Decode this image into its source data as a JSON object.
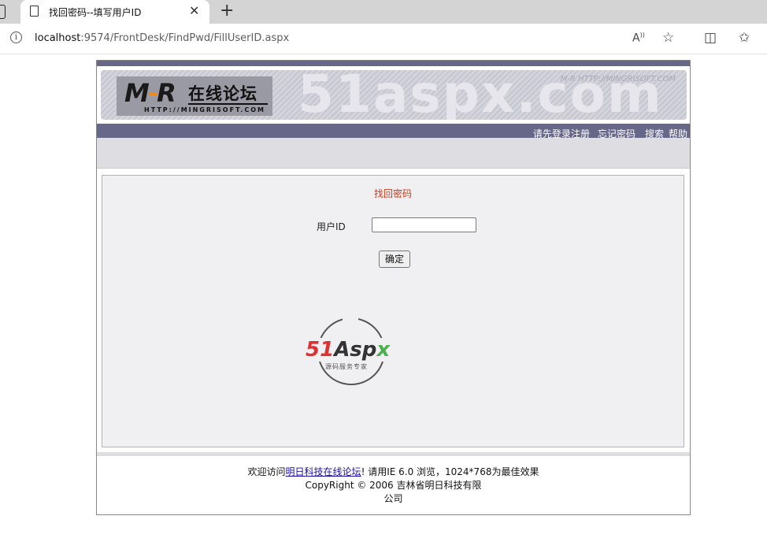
{
  "browser": {
    "tab_title": "找回密码--填写用户ID",
    "tab_close": "✕",
    "new_tab": "+",
    "url_host": "localhost",
    "url_rest": ":9574/FrontDesk/FindPwd/FillUserID.aspx"
  },
  "banner": {
    "logo_mr": "M-R",
    "logo_title": "在线论坛",
    "logo_site": "HTTP://MINGRISOFT.COM",
    "watermark": "51aspx.com",
    "watermark_url": "M-R HTTP://MINGRISOFT.COM"
  },
  "nav": {
    "login": "请先登录",
    "register": "注册",
    "forgot": "忘记密码",
    "search": "搜索",
    "help": "帮助"
  },
  "form": {
    "heading": "找回密码",
    "label_userid": "用户ID",
    "userid_value": "",
    "submit": "确定"
  },
  "seal": {
    "brand": "51Aspx",
    "tagline": "源码服务专家"
  },
  "footer": {
    "welcome": "欢迎访问",
    "link": "明日科技在线论坛",
    "tail": "! 请用IE 6.0 浏览，1024*768为最佳效果",
    "copyright": "CopyRight © 2006 吉林省明日科技有限",
    "copyright2": "公司"
  }
}
